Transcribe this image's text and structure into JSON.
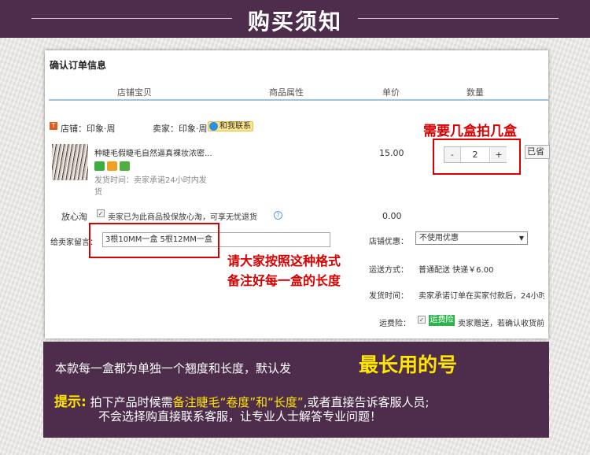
{
  "banner": {
    "title": "购买须知"
  },
  "panel": {
    "header": "确认订单信息",
    "columns": [
      "店铺宝贝",
      "商品属性",
      "单价",
      "数量"
    ],
    "shop": {
      "icon": "tmall-shop-icon",
      "label": "店铺：印象·周",
      "seller": "卖家：印象·周",
      "contact": "和我联系"
    },
    "item": {
      "title": "种睫毛假睫毛自然逼真裸妆浓密...",
      "ship_line1": "发货时间：卖家承诺24小时内发",
      "ship_line2": "货",
      "price": "15.00",
      "quantity": "2",
      "minus": "-",
      "plus": "+",
      "save_btn": "已省"
    },
    "assure": {
      "label": "放心淘",
      "text": "卖家已为此商品投保放心淘，可享无忧退货",
      "price": "0.00"
    },
    "message": {
      "label": "给卖家留言：",
      "value": "3根10MM一盒  5根12MM一盒"
    },
    "discount": {
      "label": "店铺优惠：",
      "value": "不使用优惠"
    },
    "delivery": {
      "label": "运送方式：",
      "value": "普通配送 快递￥6.00"
    },
    "ship_time": {
      "label": "发货时间：",
      "value": "卖家承诺订单在买家付款后，24小时"
    },
    "insurance": {
      "label": "运费险：",
      "tag": "运费险",
      "value": "卖家赠送，若确认收货前"
    },
    "annotations": {
      "qty_note": "需要几盒拍几盒",
      "format_note_1": "请大家按照这种格式",
      "format_note_2": "备注好每一盒的长度"
    }
  },
  "note": {
    "line1": "本款每一盒都为单独一个翘度和长度，默认发",
    "highlight": "最长用的号",
    "tip_label": "提示:",
    "line2_a": " 拍下产品时候需",
    "line2_b": "备注睫毛“卷度”和“长度”",
    "line2_c": ",或者直接告诉客服人员;",
    "line3": "不会选择购直接联系客服，让专业人士解答专业问题！"
  },
  "colors": {
    "banner": "#4d2d4b",
    "accent_yellow": "#ffe600",
    "annotation_red": "#d80000",
    "table_rule": "#9ec3e6"
  }
}
